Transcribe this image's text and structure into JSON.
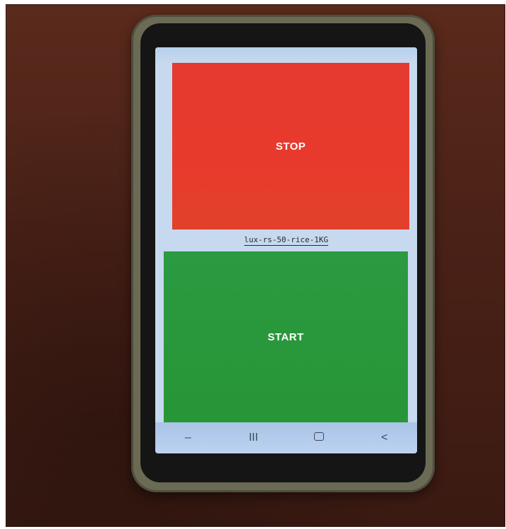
{
  "app": {
    "stop_button_label": "STOP",
    "product_name": "lux-rs-50-rice-1KG",
    "start_button_label": "START"
  },
  "nav": {
    "left_icon": "minus-icon",
    "recents_glyph": "III",
    "home_icon": "home-icon",
    "back_glyph": "<"
  },
  "colors": {
    "stop": "#e83a2c",
    "start": "#2b9a41",
    "screen_bg": "#c7d9ef"
  }
}
